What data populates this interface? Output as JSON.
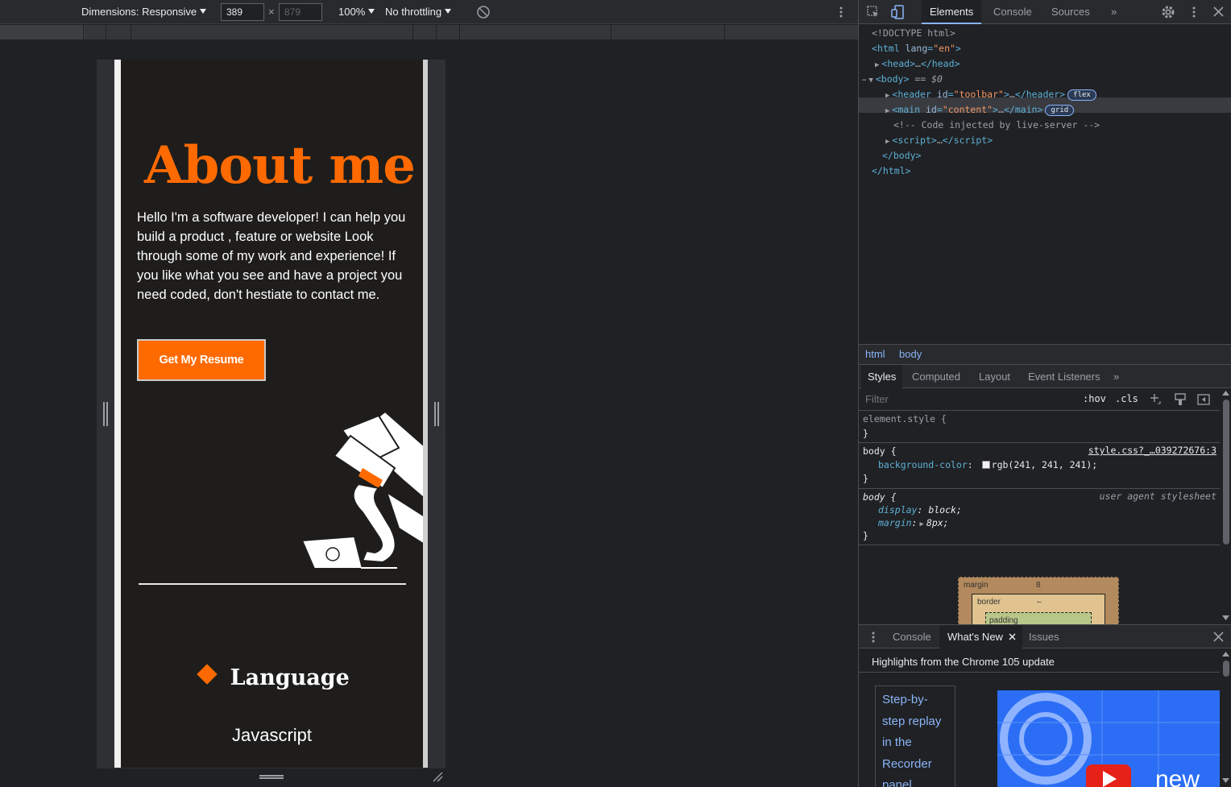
{
  "emulation_toolbar": {
    "dimensions_label": "Dimensions: Responsive",
    "width_value": "389",
    "height_placeholder": "879",
    "times_symbol": "×",
    "zoom": "100%",
    "throttling": "No throttling"
  },
  "page": {
    "about_title": "About me",
    "about_text": "Hello I'm a software developer! I can help you build a product , feature or website Look through some of my work and experience! If you like what you see and have a project you need coded, don't hestiate to contact me.",
    "resume_button": "Get My Resume",
    "language_heading": "Language",
    "language_item": "Javascript",
    "accent_color": "#ff6a00",
    "background_color": "#1e1d1c"
  },
  "devtools": {
    "tabs": [
      "Elements",
      "Console",
      "Sources"
    ],
    "more_tabs_icon": "»",
    "dom": {
      "doctype": "<!DOCTYPE html>",
      "html_tag": "html",
      "html_attr": "lang",
      "html_val": "\"en\"",
      "head": "head",
      "body_tag": "body",
      "body_marker": "== $0",
      "header_tag": "header",
      "header_attr": "id",
      "header_val": "\"toolbar\"",
      "header_badge": "flex",
      "main_tag": "main",
      "main_attr": "id",
      "main_val": "\"content\"",
      "main_badge": "grid",
      "comment": "<!-- Code injected by live-server -->",
      "script_tag": "script",
      "body_close": "</body>",
      "html_close": "</html>",
      "ellipsis": "…"
    },
    "breadcrumbs": [
      "html",
      "body"
    ],
    "style_tabs": [
      "Styles",
      "Computed",
      "Layout",
      "Event Listeners"
    ],
    "filter_placeholder": "Filter",
    "hov": ":hov",
    "cls": ".cls",
    "styles": {
      "element_style": "element.style {",
      "close_brace": "}",
      "body_selector": "body {",
      "body_source": "style.css?_…039272676:3",
      "bg_prop": "background-color",
      "bg_val": "rgb(241, 241, 241);",
      "ua_selector": "body {",
      "ua_source": "user agent stylesheet",
      "display_prop": "display",
      "display_val": "block;",
      "margin_prop": "margin",
      "margin_val": "8px;"
    },
    "box_model": {
      "margin_label": "margin",
      "margin_value": "8",
      "border_label": "border",
      "border_value": "–",
      "padding_label": "padding"
    },
    "drawer_tabs": [
      "Console",
      "What's New",
      "Issues"
    ],
    "whats_new": {
      "title": "Highlights from the Chrome 105 update",
      "link": "Step-by-step replay in the Recorder panel",
      "thumb_text": "new"
    }
  }
}
